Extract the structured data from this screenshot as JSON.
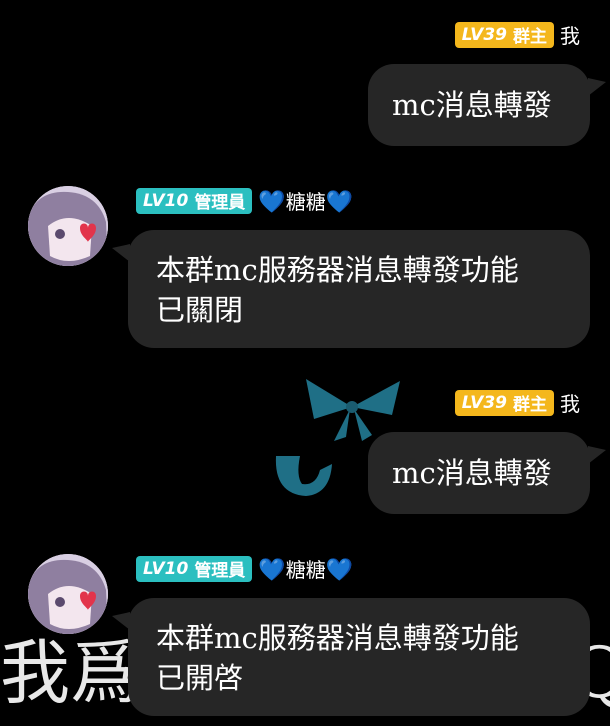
{
  "watermark": {
    "text": "我爲",
    "trailing": "Q"
  },
  "messages": [
    {
      "side": "right",
      "level": "LV39",
      "role": "群主",
      "sender": "我",
      "text": "mc消息轉發"
    },
    {
      "side": "left",
      "level": "LV10",
      "role": "管理員",
      "sender": "糖糖",
      "lines": [
        "本群mc服務器消息轉發功能",
        "已關閉"
      ]
    },
    {
      "side": "right",
      "level": "LV39",
      "role": "群主",
      "sender": "我",
      "text": "mc消息轉發"
    },
    {
      "side": "left",
      "level": "LV10",
      "role": "管理員",
      "sender": "糖糖",
      "lines": [
        "本群mc服務器消息轉發功能",
        "已開啓"
      ]
    }
  ],
  "heart_icon": "💙",
  "colors": {
    "owner_badge": "#f4b71c",
    "admin_badge": "#2bbfc0",
    "bubble": "#262626",
    "bow": "#1f6f86",
    "heart": "#3a86e8"
  }
}
